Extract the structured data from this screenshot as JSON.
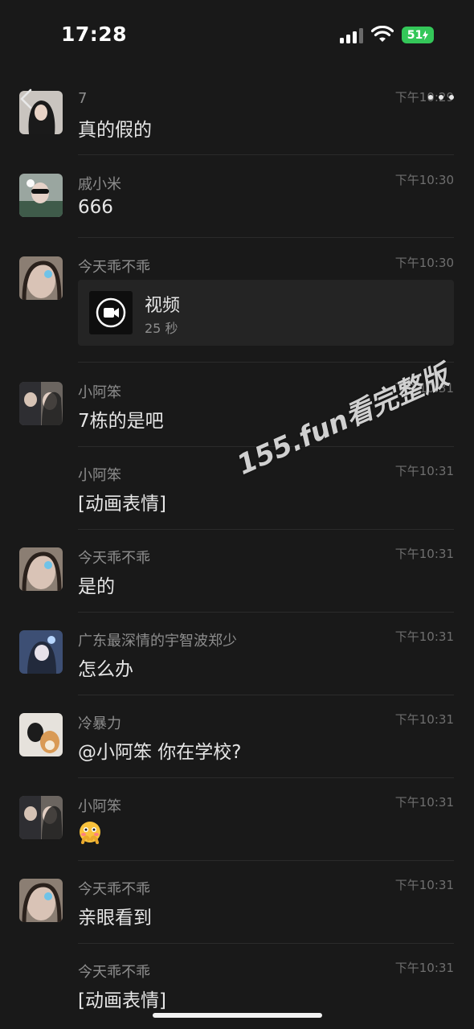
{
  "status_bar": {
    "time": "17:28",
    "battery": "51"
  },
  "messages": [
    {
      "sender": "7",
      "time": "下午10:29",
      "text": "真的假的"
    },
    {
      "sender": "戚小米",
      "time": "下午10:30",
      "text": "666"
    },
    {
      "sender": "今天乖不乖",
      "time": "下午10:30",
      "video": {
        "title": "视频",
        "duration": "25 秒"
      }
    },
    {
      "sender": "小阿笨",
      "time": "下午10:31",
      "text": "7栋的是吧"
    },
    {
      "sender": "小阿笨",
      "time": "下午10:31",
      "text": "[动画表情]"
    },
    {
      "sender": "今天乖不乖",
      "time": "下午10:31",
      "text": "是的"
    },
    {
      "sender": "广东最深情的宇智波郑少",
      "time": "下午10:31",
      "text": "怎么办"
    },
    {
      "sender": "冷暴力",
      "time": "下午10:31",
      "text": "@小阿笨 你在学校?"
    },
    {
      "sender": "小阿笨",
      "time": "下午10:31",
      "emoji": "flushed-face-with-hands"
    },
    {
      "sender": "今天乖不乖",
      "time": "下午10:31",
      "text": "亲眼看到"
    },
    {
      "sender": "今天乖不乖",
      "time": "下午10:31",
      "text": "[动画表情]"
    }
  ],
  "watermark": "155.fun看完整版",
  "icons": {
    "back": "chevron-left-icon",
    "more": "more-dots-icon",
    "video": "video-camera-icon"
  },
  "colors": {
    "background": "#191919",
    "battery": "#34c759"
  }
}
